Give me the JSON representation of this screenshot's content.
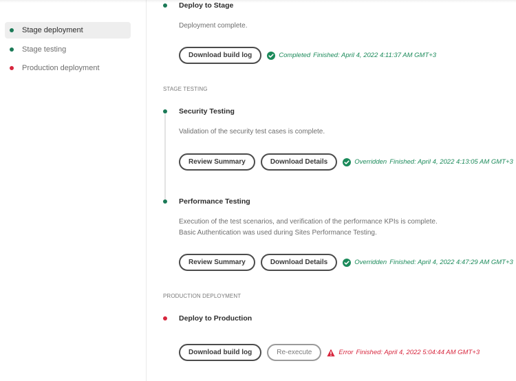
{
  "colors": {
    "success": "#1b7a57",
    "success_text": "#1b8a5a",
    "error": "#d7263d",
    "active_nav_bg": "#eeeeee"
  },
  "sidebar": {
    "items": [
      {
        "label": "Stage deployment",
        "status": "success",
        "active": true
      },
      {
        "label": "Stage testing",
        "status": "success",
        "active": false
      },
      {
        "label": "Production deployment",
        "status": "error",
        "active": false
      }
    ]
  },
  "stage_deployment": {
    "step": {
      "title": "Deploy to Stage",
      "description": "Deployment complete.",
      "buttons": [
        "Download build log"
      ],
      "status_icon": "check-circle-icon",
      "status_word": "Completed",
      "finished": "Finished: April 4, 2022 4:11:37 AM GMT+3"
    }
  },
  "stage_testing": {
    "section_label": "STAGE TESTING",
    "steps": [
      {
        "title": "Security Testing",
        "description": [
          "Validation of the security test cases is complete."
        ],
        "buttons": [
          "Review Summary",
          "Download Details"
        ],
        "status_icon": "check-circle-icon",
        "status_word": "Overridden",
        "finished": "Finished: April 4, 2022 4:13:05 AM GMT+3"
      },
      {
        "title": "Performance Testing",
        "description": [
          "Execution of the test scenarios, and verification of the performance KPIs is complete.",
          "Basic Authentication was used during Sites Performance Testing."
        ],
        "buttons": [
          "Review Summary",
          "Download Details"
        ],
        "status_icon": "check-circle-icon",
        "status_word": "Overridden",
        "finished": "Finished: April 4, 2022 4:47:29 AM GMT+3"
      }
    ]
  },
  "production_deployment": {
    "section_label": "PRODUCTION DEPLOYMENT",
    "step": {
      "title": "Deploy to Production",
      "buttons": [
        "Download build log",
        "Re-execute"
      ],
      "status_icon": "alert-triangle-icon",
      "status_word": "Error",
      "finished": "Finished: April 4, 2022 5:04:44 AM GMT+3"
    }
  }
}
